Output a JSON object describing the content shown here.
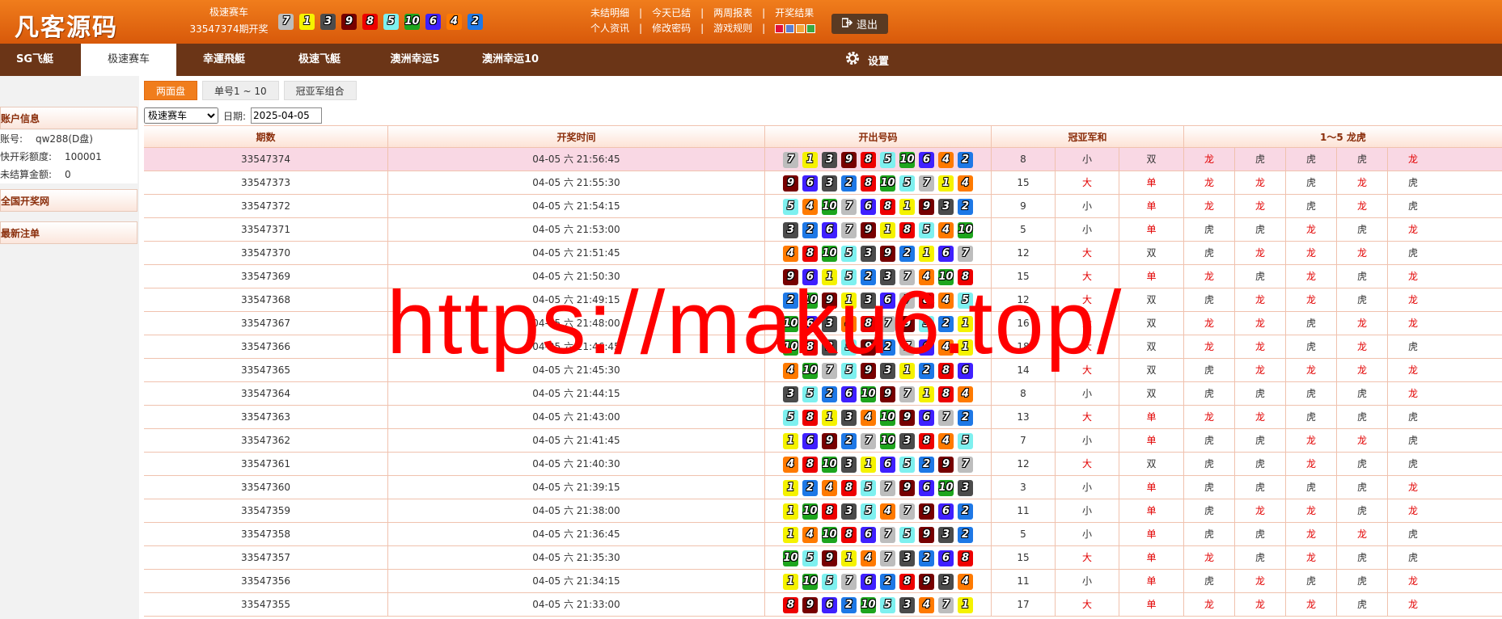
{
  "header": {
    "logo": "凡客源码",
    "game_name": "极速赛车",
    "draw_label": "33547374期开奖",
    "current_balls": [
      7,
      1,
      3,
      9,
      8,
      5,
      10,
      6,
      4,
      2
    ],
    "links_row1": [
      "未结明细",
      "今天已结",
      "两周报表",
      "开奖结果"
    ],
    "links_row2": [
      "个人资讯",
      "修改密码",
      "游戏规则"
    ],
    "theme_swatches": [
      "#e0103a",
      "#5b7fd0",
      "#f2a63a",
      "#3aa840"
    ],
    "logout": "退出"
  },
  "nav": {
    "tabs": [
      "SG飞艇",
      "极速赛车",
      "幸運飛艇",
      "极速飞艇",
      "澳洲幸运5",
      "澳洲幸运10"
    ],
    "active": 1,
    "settings": "设置"
  },
  "left": {
    "account_title": "账户信息",
    "account_label": "账号:",
    "account_value": "qw288(D盘)",
    "quota_label": "快开彩额度:",
    "quota_value": "100001",
    "unsettled_label": "未结算金额:",
    "unsettled_value": "0",
    "national_title": "全国开奖网",
    "latest_title": "最新注单"
  },
  "subtabs": [
    "两面盘",
    "单号1 ~ 10",
    "冠亚军组合"
  ],
  "filter": {
    "game_select": "极速赛车",
    "date_label": "日期:",
    "date_value": "2025-04-05"
  },
  "table": {
    "headers": [
      "期数",
      "开奖时间",
      "开出号码",
      "冠亚军和",
      "1～5 龙虎"
    ],
    "rows": [
      {
        "no": "33547374",
        "time": "04-05 六 21:56:45",
        "balls": [
          7,
          1,
          3,
          9,
          8,
          5,
          10,
          6,
          4,
          2
        ],
        "sum": "8",
        "bs": "小",
        "oe": "双",
        "lh": [
          "龙",
          "虎",
          "虎",
          "虎",
          "龙"
        ]
      },
      {
        "no": "33547373",
        "time": "04-05 六 21:55:30",
        "balls": [
          9,
          6,
          3,
          2,
          8,
          10,
          5,
          7,
          1,
          4
        ],
        "sum": "15",
        "bs": "大",
        "oe": "单",
        "lh": [
          "龙",
          "龙",
          "虎",
          "龙",
          "虎"
        ]
      },
      {
        "no": "33547372",
        "time": "04-05 六 21:54:15",
        "balls": [
          5,
          4,
          10,
          7,
          6,
          8,
          1,
          9,
          3,
          2
        ],
        "sum": "9",
        "bs": "小",
        "oe": "单",
        "lh": [
          "龙",
          "龙",
          "虎",
          "龙",
          "虎"
        ]
      },
      {
        "no": "33547371",
        "time": "04-05 六 21:53:00",
        "balls": [
          3,
          2,
          6,
          7,
          9,
          1,
          8,
          5,
          4,
          10
        ],
        "sum": "5",
        "bs": "小",
        "oe": "单",
        "lh": [
          "虎",
          "虎",
          "龙",
          "虎",
          "龙"
        ]
      },
      {
        "no": "33547370",
        "time": "04-05 六 21:51:45",
        "balls": [
          4,
          8,
          10,
          5,
          3,
          9,
          2,
          1,
          6,
          7
        ],
        "sum": "12",
        "bs": "大",
        "oe": "双",
        "lh": [
          "虎",
          "龙",
          "龙",
          "龙",
          "虎"
        ]
      },
      {
        "no": "33547369",
        "time": "04-05 六 21:50:30",
        "balls": [
          9,
          6,
          1,
          5,
          2,
          3,
          7,
          4,
          10,
          8
        ],
        "sum": "15",
        "bs": "大",
        "oe": "单",
        "lh": [
          "龙",
          "虎",
          "龙",
          "虎",
          "龙"
        ]
      },
      {
        "no": "33547368",
        "time": "04-05 六 21:49:15",
        "balls": [
          2,
          10,
          9,
          1,
          3,
          6,
          7,
          8,
          4,
          5
        ],
        "sum": "12",
        "bs": "大",
        "oe": "双",
        "lh": [
          "虎",
          "龙",
          "龙",
          "虎",
          "龙"
        ]
      },
      {
        "no": "33547367",
        "time": "04-05 六 21:48:00",
        "balls": [
          10,
          6,
          3,
          4,
          8,
          7,
          9,
          5,
          2,
          1
        ],
        "sum": "16",
        "bs": "大",
        "oe": "双",
        "lh": [
          "龙",
          "龙",
          "虎",
          "龙",
          "龙"
        ]
      },
      {
        "no": "33547366",
        "time": "04-05 六 21:46:45",
        "balls": [
          10,
          8,
          3,
          5,
          9,
          2,
          7,
          6,
          4,
          1
        ],
        "sum": "18",
        "bs": "大",
        "oe": "双",
        "lh": [
          "龙",
          "龙",
          "虎",
          "龙",
          "虎"
        ]
      },
      {
        "no": "33547365",
        "time": "04-05 六 21:45:30",
        "balls": [
          4,
          10,
          7,
          5,
          9,
          3,
          1,
          2,
          8,
          6
        ],
        "sum": "14",
        "bs": "大",
        "oe": "双",
        "lh": [
          "虎",
          "龙",
          "龙",
          "龙",
          "龙"
        ]
      },
      {
        "no": "33547364",
        "time": "04-05 六 21:44:15",
        "balls": [
          3,
          5,
          2,
          6,
          10,
          9,
          7,
          1,
          8,
          4
        ],
        "sum": "8",
        "bs": "小",
        "oe": "双",
        "lh": [
          "虎",
          "虎",
          "虎",
          "虎",
          "龙"
        ]
      },
      {
        "no": "33547363",
        "time": "04-05 六 21:43:00",
        "balls": [
          5,
          8,
          1,
          3,
          4,
          10,
          9,
          6,
          7,
          2
        ],
        "sum": "13",
        "bs": "大",
        "oe": "单",
        "lh": [
          "龙",
          "龙",
          "虎",
          "虎",
          "虎"
        ]
      },
      {
        "no": "33547362",
        "time": "04-05 六 21:41:45",
        "balls": [
          1,
          6,
          9,
          2,
          7,
          10,
          3,
          8,
          4,
          5
        ],
        "sum": "7",
        "bs": "小",
        "oe": "单",
        "lh": [
          "虎",
          "虎",
          "龙",
          "龙",
          "虎"
        ]
      },
      {
        "no": "33547361",
        "time": "04-05 六 21:40:30",
        "balls": [
          4,
          8,
          10,
          3,
          1,
          6,
          5,
          2,
          9,
          7
        ],
        "sum": "12",
        "bs": "大",
        "oe": "双",
        "lh": [
          "虎",
          "虎",
          "龙",
          "虎",
          "虎"
        ]
      },
      {
        "no": "33547360",
        "time": "04-05 六 21:39:15",
        "balls": [
          1,
          2,
          4,
          8,
          5,
          7,
          9,
          6,
          10,
          3
        ],
        "sum": "3",
        "bs": "小",
        "oe": "单",
        "lh": [
          "虎",
          "虎",
          "虎",
          "虎",
          "龙"
        ]
      },
      {
        "no": "33547359",
        "time": "04-05 六 21:38:00",
        "balls": [
          1,
          10,
          8,
          3,
          5,
          4,
          7,
          9,
          6,
          2
        ],
        "sum": "11",
        "bs": "小",
        "oe": "单",
        "lh": [
          "虎",
          "龙",
          "龙",
          "虎",
          "龙"
        ]
      },
      {
        "no": "33547358",
        "time": "04-05 六 21:36:45",
        "balls": [
          1,
          4,
          10,
          8,
          6,
          7,
          5,
          9,
          3,
          2
        ],
        "sum": "5",
        "bs": "小",
        "oe": "单",
        "lh": [
          "虎",
          "虎",
          "龙",
          "龙",
          "虎"
        ]
      },
      {
        "no": "33547357",
        "time": "04-05 六 21:35:30",
        "balls": [
          10,
          5,
          9,
          1,
          4,
          7,
          3,
          2,
          6,
          8
        ],
        "sum": "15",
        "bs": "大",
        "oe": "单",
        "lh": [
          "龙",
          "虎",
          "龙",
          "虎",
          "虎"
        ]
      },
      {
        "no": "33547356",
        "time": "04-05 六 21:34:15",
        "balls": [
          1,
          10,
          5,
          7,
          6,
          2,
          8,
          9,
          3,
          4
        ],
        "sum": "11",
        "bs": "小",
        "oe": "单",
        "lh": [
          "虎",
          "龙",
          "虎",
          "虎",
          "龙"
        ]
      },
      {
        "no": "33547355",
        "time": "04-05 六 21:33:00",
        "balls": [
          8,
          9,
          6,
          2,
          10,
          5,
          3,
          4,
          7,
          1
        ],
        "sum": "17",
        "bs": "大",
        "oe": "单",
        "lh": [
          "龙",
          "龙",
          "龙",
          "虎",
          "龙"
        ]
      }
    ]
  },
  "ball_colors": {
    "1": "#f5f200",
    "2": "#1e78e6",
    "3": "#4b4b4b",
    "4": "#ff7a00",
    "5": "#7ef0ef",
    "6": "#3f20ff",
    "7": "#bdbdbd",
    "8": "#ee0000",
    "9": "#770000",
    "10": "#1ea51e"
  },
  "watermark": "https://maku6.top/"
}
